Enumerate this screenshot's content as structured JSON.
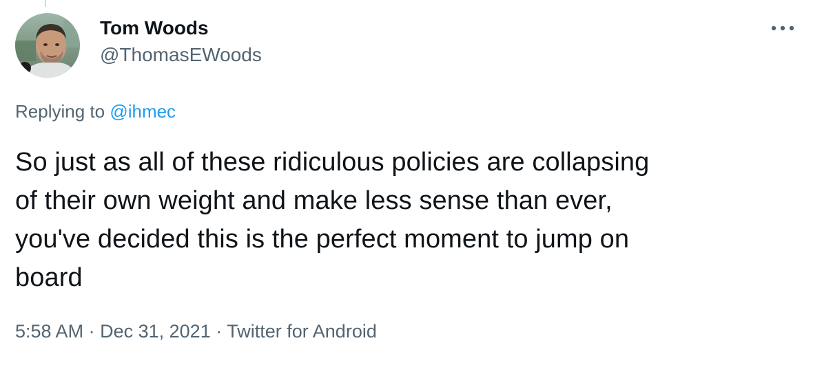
{
  "author": {
    "name": "Tom Woods",
    "handle": "@ThomasEWoods",
    "avatar_icon": "profile-photo"
  },
  "more_icon": "ellipsis-icon",
  "reply": {
    "prefix": "Replying to",
    "mention": "@ihmec"
  },
  "tweet": {
    "lines": [
      "So just as all of these ridiculous policies are collapsing",
      "of their own weight and make less sense than ever,",
      "you've decided this is the perfect moment to jump on",
      "board"
    ]
  },
  "meta": {
    "time": "5:58 AM",
    "separator": "·",
    "date": "Dec 31, 2021",
    "source": "Twitter for Android"
  },
  "colors": {
    "text": "#0f1419",
    "secondary": "#536471",
    "link": "#1d9bf0",
    "background": "#ffffff"
  }
}
